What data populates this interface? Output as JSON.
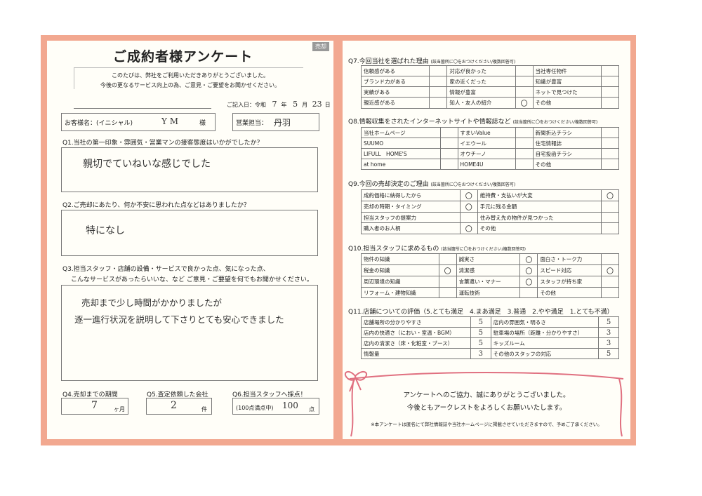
{
  "doc": {
    "title": "ご成約者様アンケート",
    "tag": "売却",
    "intro1": "このたびは、弊社をご利用いただきありがとうございました。",
    "intro2": "今後の更なるサービス向上の為、ご意見・ご要望をお聞かせください。",
    "date_label": "ご記入日：令和",
    "date_year": "7",
    "date_year_unit": "年",
    "date_month": "5",
    "date_month_unit": "月",
    "date_day": "23",
    "date_day_unit": "日",
    "customer_label": "お客様名：(イニシャル)",
    "customer_value": "Y M",
    "customer_suffix": "様",
    "staff_label": "営業担当：",
    "staff_value": "丹羽",
    "q1": "Q1.当社の第一印象・雰囲気・営業マンの接客態度はいかがでしたか？",
    "a1": "親切でていねいな感じでした",
    "q2": "Q2.ご売却にあたり、何か不安に思われた点などはありましたか？",
    "a2": "特になし",
    "q3_line1": "Q3.担当スタッフ・店舗の設備・サービスで良かった点、気になった点、",
    "q3_line2": "こんなサービスがあったらいいな、など ご意見・ご要望を何でもお聞かせください。",
    "a3_line1": "売却まで少し時間がかかりましたが",
    "a3_line2": "逐一進行状況を説明して下さりとても安心できました",
    "q4": "Q4.売却までの期間",
    "a4": "7",
    "a4_unit": "ヶ月",
    "q5": "Q5.査定依頼した会社",
    "a5": "2",
    "a5_unit": "件",
    "q6": "Q6.担当スタッフへ採点！",
    "q6_note": "(100点満点中)",
    "a6": "100",
    "a6_unit": "点"
  },
  "q7": {
    "heading": "Q7.今回当社を選ばれた理由",
    "sub": "(該当箇所に〇をおつけください/複数回答可)",
    "rows": [
      [
        "信頼感がある",
        "",
        "対応が良かった",
        "",
        "当社専任物件",
        ""
      ],
      [
        "ブランド力がある",
        "",
        "家の近くだった",
        "",
        "知識が豊富",
        ""
      ],
      [
        "実績がある",
        "",
        "情報が豊富",
        "",
        "ネットで見つけた",
        ""
      ],
      [
        "親近感がある",
        "",
        "知人・友人の紹介",
        "〇",
        "その他",
        ""
      ]
    ]
  },
  "q8": {
    "heading": "Q8.情報収集をされたインターネットサイトや情報誌など",
    "sub": "(該当箇所に〇をおつけください/複数回答可)",
    "rows": [
      [
        "当社ホームページ",
        "",
        "すまいValue",
        "",
        "新聞折込チラシ",
        ""
      ],
      [
        "SUUMO",
        "",
        "イエウール",
        "",
        "住宅情報誌",
        ""
      ],
      [
        "LIFULL　HOME'S",
        "",
        "オウチーノ",
        "",
        "自宅投函チラシ",
        ""
      ],
      [
        "at home",
        "",
        "HOME4U",
        "",
        "その他",
        ""
      ]
    ]
  },
  "q9": {
    "heading": "Q9.今回の売却決定のご理由",
    "sub": "(該当箇所に〇をおつけください/複数回答可)",
    "rows": [
      [
        "成約価格に納得したから",
        "〇",
        "維持費・支払いが大変",
        "〇"
      ],
      [
        "売却の時期・タイミング",
        "〇",
        "手元に残る金額",
        ""
      ],
      [
        "担当スタッフの提案力",
        "",
        "住み替え先の物件が見つかった",
        ""
      ],
      [
        "購入者のお人柄",
        "〇",
        "その他",
        ""
      ]
    ]
  },
  "q10": {
    "heading": "Q10.担当スタッフに求めるもの",
    "sub": "(該当箇所に〇をおつけください/複数回答可)",
    "rows": [
      [
        "物件の知識",
        "",
        "誠実さ",
        "〇",
        "面白さ・トーク力",
        ""
      ],
      [
        "税金の知識",
        "〇",
        "清潔感",
        "〇",
        "スピード対応",
        "〇"
      ],
      [
        "周辺環境の知識",
        "",
        "言葉遣い・マナー",
        "〇",
        "スタッフが持ち家",
        ""
      ],
      [
        "リフォーム・建物知識",
        "",
        "運転技術",
        "",
        "その他",
        ""
      ]
    ]
  },
  "q11": {
    "heading": "Q11.店舗についての評価（5.とても満足　4.まあ満足　3.普通　2.やや満足　1.とても不満）",
    "rows": [
      [
        "店舗場所の分かりやすさ",
        "5",
        "店内の雰囲気・明るさ",
        "5"
      ],
      [
        "店内の快適さ（におい・室温・BGM）",
        "5",
        "駐車場の場所（距離・分かりやすさ）",
        "3"
      ],
      [
        "店内の清潔さ（床・化粧室・ブース）",
        "5",
        "キッズルーム",
        "3"
      ],
      [
        "情報量",
        "3",
        "その他のスタッフの対応",
        "5"
      ]
    ]
  },
  "closing": {
    "line1": "アンケートへのご協力、誠にありがとうございました。",
    "line2": "今後ともアークレストをよろしくお願いいたします。",
    "note": "※本アンケートは匿名にて弊社情報誌や当社ホームページに掲載させていただきますので、予めご了承ください。"
  },
  "colors": {
    "frame": "#f2a890",
    "ribbon": "#e07080"
  }
}
